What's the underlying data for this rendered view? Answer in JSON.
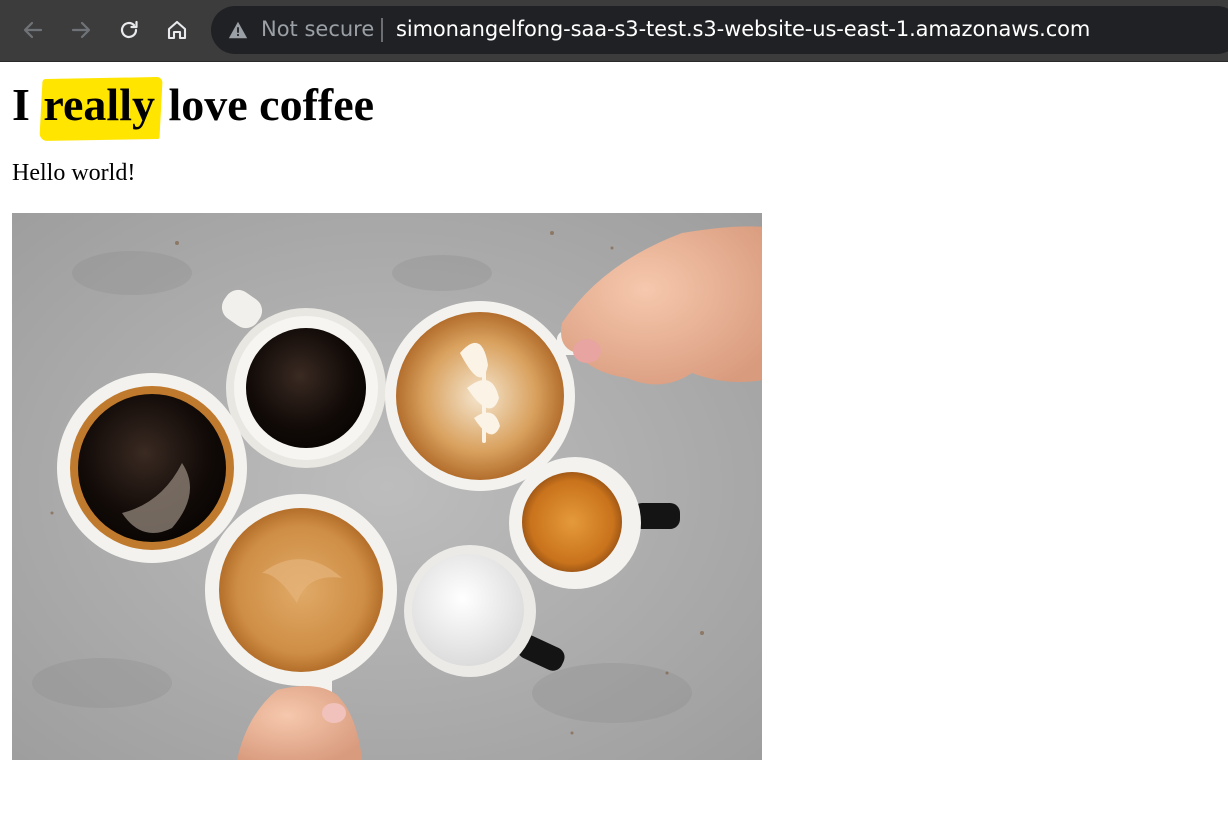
{
  "browser": {
    "security_status": "Not secure",
    "url": "simonangelfong-saa-s3-test.s3-website-us-east-1.amazonaws.com",
    "icons": {
      "back": "back-arrow-icon",
      "forward": "forward-arrow-icon",
      "reload": "reload-icon",
      "home": "home-icon",
      "warning": "warning-icon"
    }
  },
  "page": {
    "heading_prefix": "I ",
    "heading_highlight": "really",
    "heading_suffix": " love coffee",
    "highlight_color": "#ffe500",
    "paragraph": "Hello world!"
  }
}
